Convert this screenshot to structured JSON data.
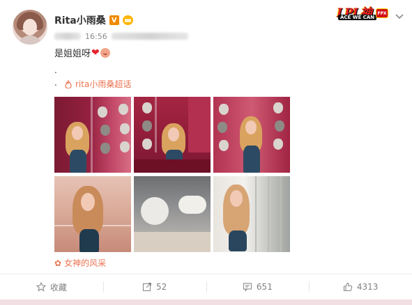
{
  "post": {
    "username": "Rita小雨桑",
    "verified_badge": "V",
    "time": "16:56",
    "text": "是姐姐呀",
    "dot_line_1": ".",
    "dot_line_2": ".",
    "topic": "rita小雨桑超话",
    "caption": "女神的风采"
  },
  "logo": {
    "title": "LPL神",
    "subtitle": "ACE WE CAN",
    "badge": "FPX"
  },
  "actions": {
    "favorite_label": "收藏",
    "repost_count": "52",
    "comment_count": "651",
    "like_count": "4313"
  },
  "colors": {
    "accent": "#eb7350",
    "heart": "#e8232d",
    "verified": "#f08a00"
  },
  "icons": [
    "chevron-down-icon",
    "fire-topic-icon",
    "flower-icon",
    "star-icon",
    "repost-icon",
    "comment-icon",
    "thumbs-up-icon"
  ]
}
